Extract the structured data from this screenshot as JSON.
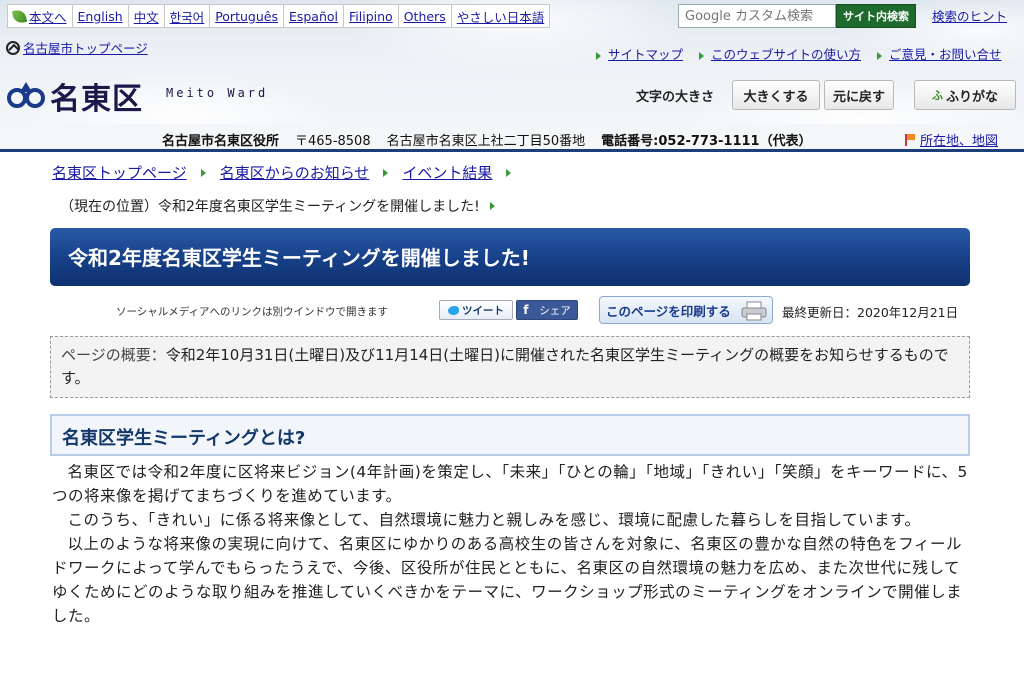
{
  "header": {
    "languages": [
      {
        "label": "本文へ"
      },
      {
        "label": "English"
      },
      {
        "label": "中文"
      },
      {
        "label": "한국어"
      },
      {
        "label": "Português"
      },
      {
        "label": "Español"
      },
      {
        "label": "Filipino"
      },
      {
        "label": "Others"
      },
      {
        "label": "やさしい日本語"
      }
    ],
    "search": {
      "placeholder": "Google カスタム検索",
      "button_label": "サイト内検索",
      "hint_label": "検索のヒント"
    },
    "nagoya_top_label": "名古屋市トップページ",
    "utility_links": [
      {
        "label": "サイトマップ"
      },
      {
        "label": "このウェブサイトの使い方"
      },
      {
        "label": "ご意見・お問い合せ"
      }
    ],
    "logo": {
      "name": "名東区",
      "roman": "Meito Ward"
    },
    "font_size": {
      "label": "文字の大きさ",
      "larger_label": "大きくする",
      "reset_label": "元に戻す"
    },
    "furigana_label": "ふりがな",
    "furigana_icon_text": "ふ",
    "address": {
      "office": "名古屋市名東区役所",
      "postal": "〒465-8508",
      "street": "名古屋市名東区上社二丁目50番地",
      "phone": "電話番号:052-773-1111（代表）"
    },
    "map_link_label": "所在地、地図"
  },
  "breadcrumb": [
    {
      "label": "名東区トップページ"
    },
    {
      "label": "名東区からのお知らせ"
    },
    {
      "label": "イベント結果"
    }
  ],
  "current_position": "（現在の位置）令和2年度名東区学生ミーティングを開催しました!",
  "page_title": "令和2年度名東区学生ミーティングを開催しました!",
  "social": {
    "note": "ソーシャルメディアへのリンクは別ウインドウで開きます",
    "tweet_label": "ツイート",
    "share_label": "シェア",
    "print_label": "このページを印刷する",
    "last_updated": "最終更新日：2020年12月21日"
  },
  "summary": {
    "label": "ページの概要：",
    "text": "令和2年10月31日(土曜日)及び11月14日(土曜日)に開催された名東区学生ミーティングの概要をお知らせするものです。"
  },
  "section_heading": "名東区学生ミーティングとは?",
  "paragraphs": [
    "名東区では令和2年度に区将来ビジョン(4年計画)を策定し、「未来」「ひとの輪」「地域」「きれい」「笑顔」をキーワードに、5つの将来像を掲げてまちづくりを進めています。",
    "このうち、「きれい」に係る将来像として、自然環境に魅力と親しみを感じ、環境に配慮した暮らしを目指しています。",
    "以上のような将来像の実現に向けて、名東区にゆかりのある高校生の皆さんを対象に、名東区の豊かな自然の特色をフィールドワークによって学んでもらったうえで、今後、区役所が住民とともに、名東区の自然環境の魅力を広め、また次世代に残してゆくためにどのような取り組みを推進していくべきかをテーマに、ワークショップ形式のミーティングをオンラインで開催しました。"
  ],
  "colors": {
    "title_bg": "#163f86",
    "link": "#1a1aa6",
    "accent_green": "#3a9a3a",
    "search_button": "#1f6b2e"
  }
}
